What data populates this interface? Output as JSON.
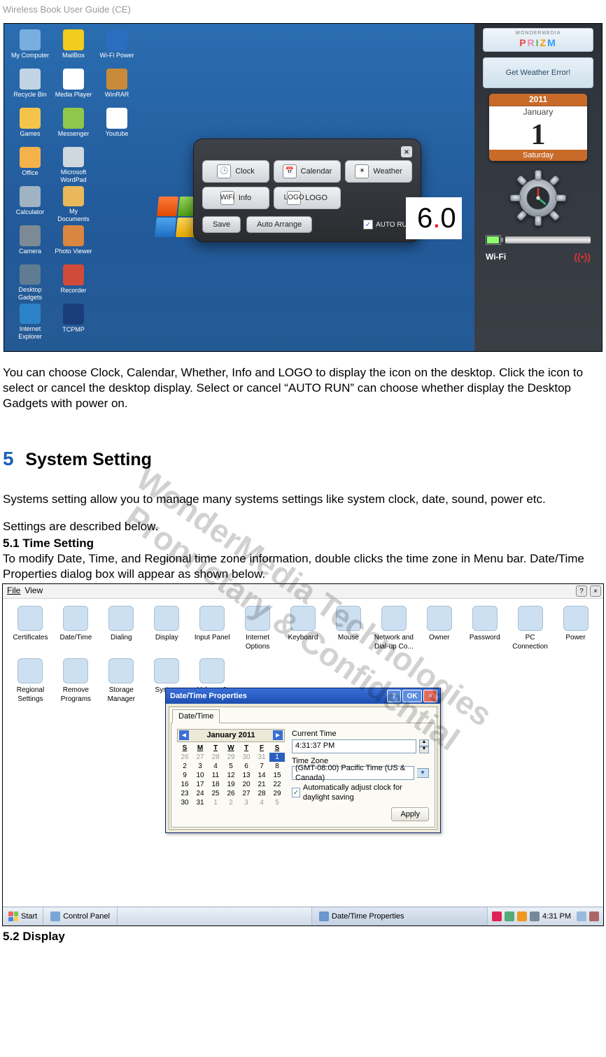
{
  "header": "Wireless Book User Guide (CE)",
  "watermark": {
    "line1": "WonderMedia Technologies",
    "line2": "Proprietary & Confidential"
  },
  "desktop": {
    "icons": [
      {
        "label": "My Computer",
        "color": "#78aee0"
      },
      {
        "label": "MailBox",
        "color": "#f2cc1e"
      },
      {
        "label": "Wi-Fi Power",
        "color": "#2b6ec0"
      },
      {
        "label": "Recycle Bin",
        "color": "#c0d4e4"
      },
      {
        "label": "Media Player",
        "color": "#fff"
      },
      {
        "label": "WinRAR",
        "color": "#c98a3a"
      },
      {
        "label": "Games",
        "color": "#f2c54a"
      },
      {
        "label": "Messenger",
        "color": "#8ec74c"
      },
      {
        "label": "Youtube",
        "color": "#fff"
      },
      {
        "label": "Office",
        "color": "#f4b24a"
      },
      {
        "label": "Microsoft WordPad",
        "color": "#cfd8df"
      },
      {
        "label": "",
        "color": "transparent"
      },
      {
        "label": "Calculator",
        "color": "#9fb3c3"
      },
      {
        "label": "My Documents",
        "color": "#e8b85a"
      },
      {
        "label": "",
        "color": "transparent"
      },
      {
        "label": "Camera",
        "color": "#7c8a95"
      },
      {
        "label": "Photo Viewer",
        "color": "#d98640"
      },
      {
        "label": "",
        "color": "transparent"
      },
      {
        "label": "Desktop Gadgets",
        "color": "#5f7c92"
      },
      {
        "label": "Recorder",
        "color": "#d14a3a"
      },
      {
        "label": "",
        "color": "transparent"
      },
      {
        "label": "Internet Explorer",
        "color": "#2c83c7"
      },
      {
        "label": "TCPMP",
        "color": "#1a3d7a"
      }
    ],
    "dialog": {
      "items": [
        {
          "icon": "🕒",
          "label": "Clock"
        },
        {
          "icon": "📅",
          "label": "Calendar"
        },
        {
          "icon": "☀",
          "label": "Weather"
        },
        {
          "icon": "WiFi",
          "label": "Info"
        },
        {
          "icon": "LOGO",
          "label": "LOGO"
        }
      ],
      "save": "Save",
      "auto_arrange": "Auto Arrange",
      "autorun": "AUTO RUN"
    },
    "six": {
      "a": "6",
      "b": "0"
    }
  },
  "sidebar": {
    "brand_top": "WONDERMEDIA",
    "weather": "Get Weather Error!",
    "calendar": {
      "year": "2011",
      "month": "January",
      "day": "1",
      "dow": "Saturday"
    },
    "wifi": "Wi-Fi"
  },
  "text": {
    "p1": "You can choose Clock, Calendar, Whether, Info and LOGO to display the icon on the desktop. Click the icon to select or cancel the desktop display. Select or cancel “AUTO RUN” can choose whether display the Desktop Gadgets with power on.",
    "sec5_num": "5",
    "sec5_title": "System Setting",
    "p2": "Systems setting allow you to manage many systems settings like system clock, date, sound, power etc.",
    "p3": "Settings are described below.",
    "sub51": "5.1   Time Setting",
    "p4": "To modify Date, Time, and Regional time zone information, double clicks the time zone in Menu bar. Date/Time Properties dialog box will appear as shown below.",
    "sub52": "5.2   Display"
  },
  "control_panel": {
    "menu": {
      "file": "File",
      "view": "View"
    },
    "row1": [
      "Certificates",
      "Date/Time",
      "Dialing",
      "Display",
      "Input Panel",
      "Internet Options",
      "Keyboard",
      "Mouse",
      "Network and Dial-up Co...",
      "Owner",
      "Password",
      "PC Connection",
      "Power"
    ],
    "row2": [
      "Regional Settings",
      "Remove Programs",
      "Storage Manager",
      "System",
      "Volume & Sounds"
    ]
  },
  "datetime": {
    "title": "Date/Time Properties",
    "ok": "OK",
    "tab": "Date/Time",
    "cal_title": "January 2011",
    "dows": [
      "S",
      "M",
      "T",
      "W",
      "T",
      "F",
      "S"
    ],
    "weeks": [
      [
        "26",
        "27",
        "28",
        "29",
        "30",
        "31",
        "1"
      ],
      [
        "2",
        "3",
        "4",
        "5",
        "6",
        "7",
        "8"
      ],
      [
        "9",
        "10",
        "11",
        "12",
        "13",
        "14",
        "15"
      ],
      [
        "16",
        "17",
        "18",
        "19",
        "20",
        "21",
        "22"
      ],
      [
        "23",
        "24",
        "25",
        "26",
        "27",
        "28",
        "29"
      ],
      [
        "30",
        "31",
        "1",
        "2",
        "3",
        "4",
        "5"
      ]
    ],
    "grey_first": 6,
    "grey_last_start": 2,
    "selected": "1",
    "current_time_label": "Current Time",
    "current_time": "4:31:37 PM",
    "tz_label": "Time Zone",
    "tz_value": "(GMT-08:00) Pacific Time (US & Canada)",
    "dst": "Automatically adjust clock for daylight saving",
    "apply": "Apply"
  },
  "taskbar": {
    "start": "Start",
    "items": [
      {
        "label": "Control Panel"
      },
      {
        "label": "Date/Time Properties"
      }
    ],
    "clock": "4:31 PM"
  }
}
